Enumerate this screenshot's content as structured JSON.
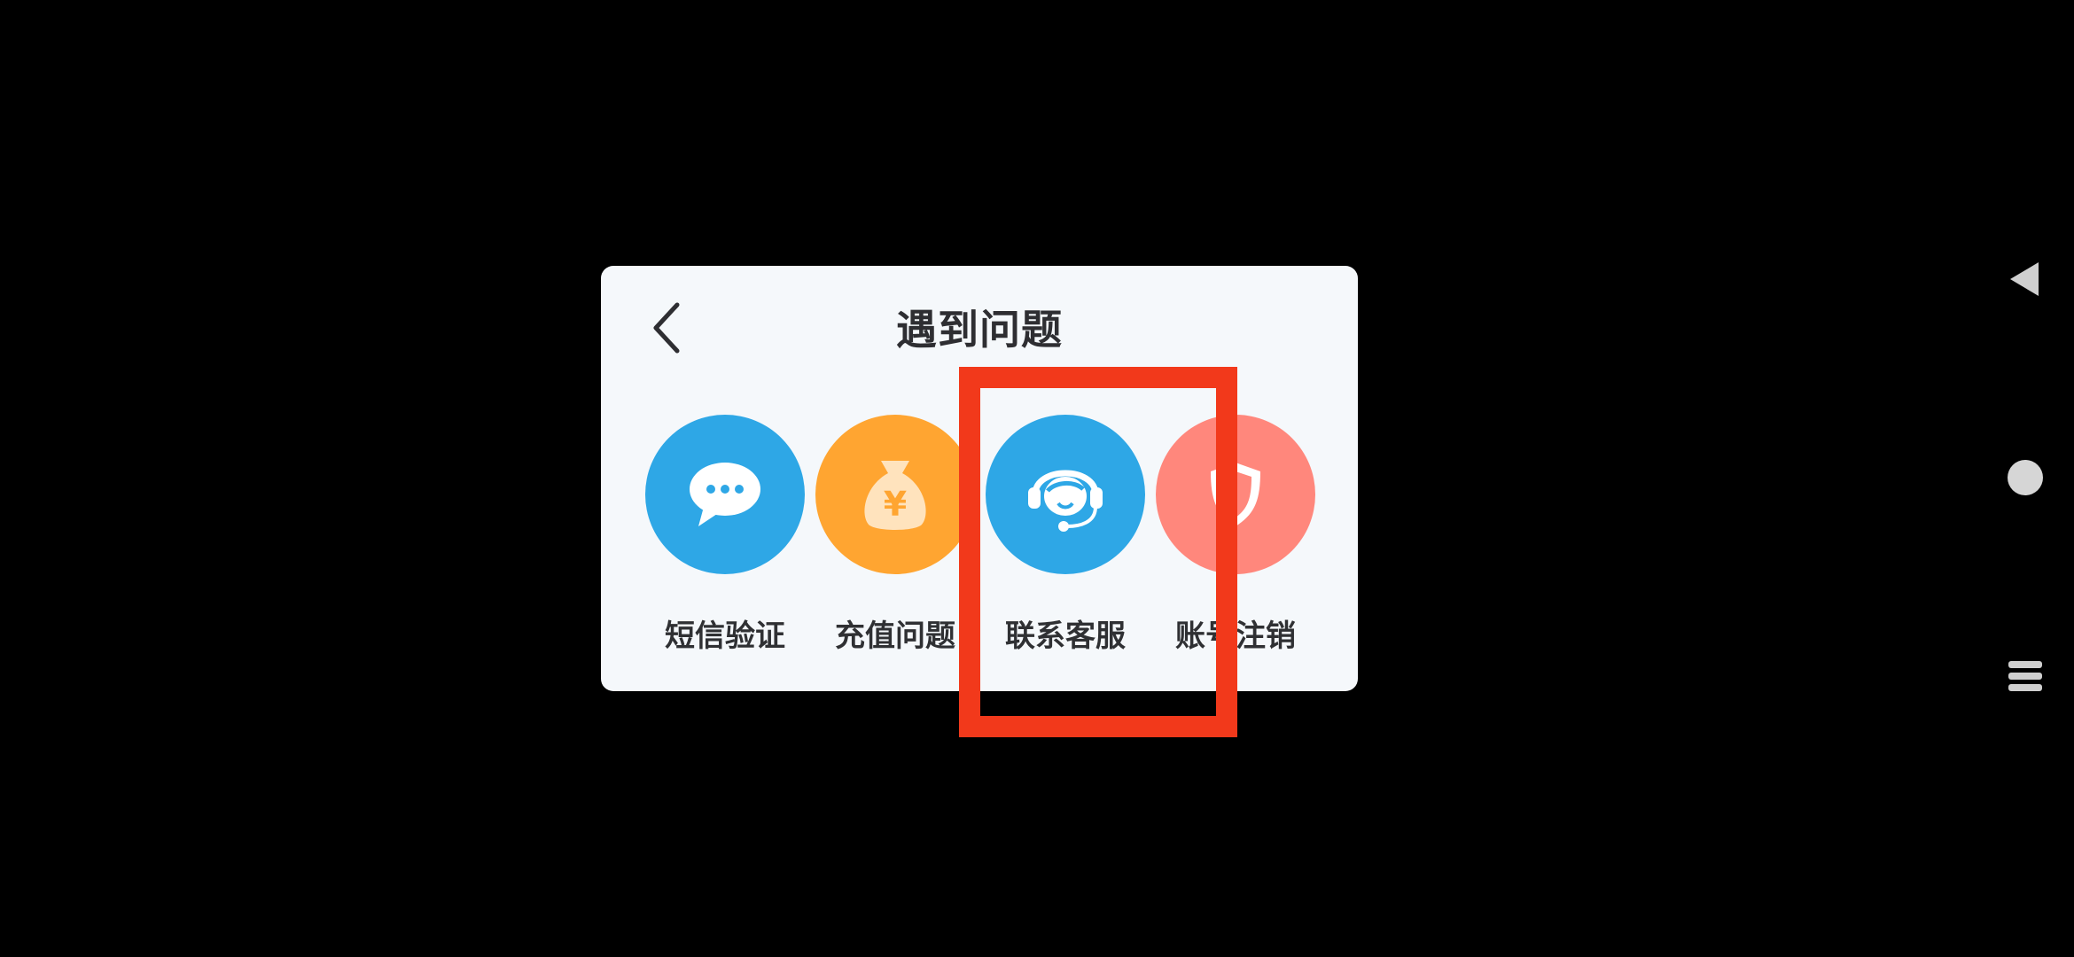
{
  "dialog": {
    "title": "遇到问题",
    "back_icon": "chevron-left-icon",
    "options": [
      {
        "label": "短信验证",
        "icon": "chat-bubble-icon",
        "color": "#2ea7e6"
      },
      {
        "label": "充值问题",
        "icon": "money-bag-icon",
        "color": "#ffa531"
      },
      {
        "label": "联系客服",
        "icon": "customer-service-headset-icon",
        "color": "#2ea7e6"
      },
      {
        "label": "账号注销",
        "icon": "shield-icon",
        "color": "#ff877c"
      }
    ]
  },
  "highlight": {
    "target": "联系客服",
    "color": "#f2391b"
  },
  "nav_bar": {
    "buttons": [
      "back-triangle-icon",
      "home-circle-icon",
      "menu-lines-icon"
    ]
  }
}
